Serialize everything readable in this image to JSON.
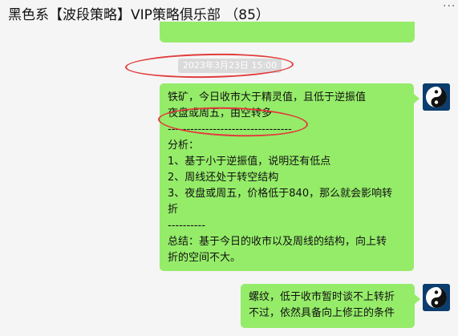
{
  "header": {
    "title": "黑色系【波段策略】VIP策略俱乐部 （85）",
    "more_label": "···"
  },
  "messages": [
    {
      "timestamp": "2023年3月23日 15:00",
      "lines": [
        "铁矿，今日收市大于精灵值，且低于逆振值",
        "夜盘或周五，由空转多",
        "---------------------------------",
        "分析：",
        "1、基于小于逆振值，说明还有低点",
        "2、周线还处于转空结构",
        "3、夜盘或周五，价格低于840，那么就会影响转",
        "折",
        "----------",
        "总结：基于今日的收市以及周线的结构，向上转",
        "折的空间不大。"
      ]
    },
    {
      "lines": [
        "螺纹，低于收市暂时谈不上转折",
        "不过，依然具备向上修正的条件"
      ]
    }
  ],
  "colors": {
    "background": "#f5f5f5",
    "bubble": "#95ec69",
    "timestamp_bg": "#dadada",
    "annotation": "#e23b3b",
    "avatar_bg": "#0b3d6e"
  },
  "icons": {
    "avatar": "yin-yang-icon"
  }
}
